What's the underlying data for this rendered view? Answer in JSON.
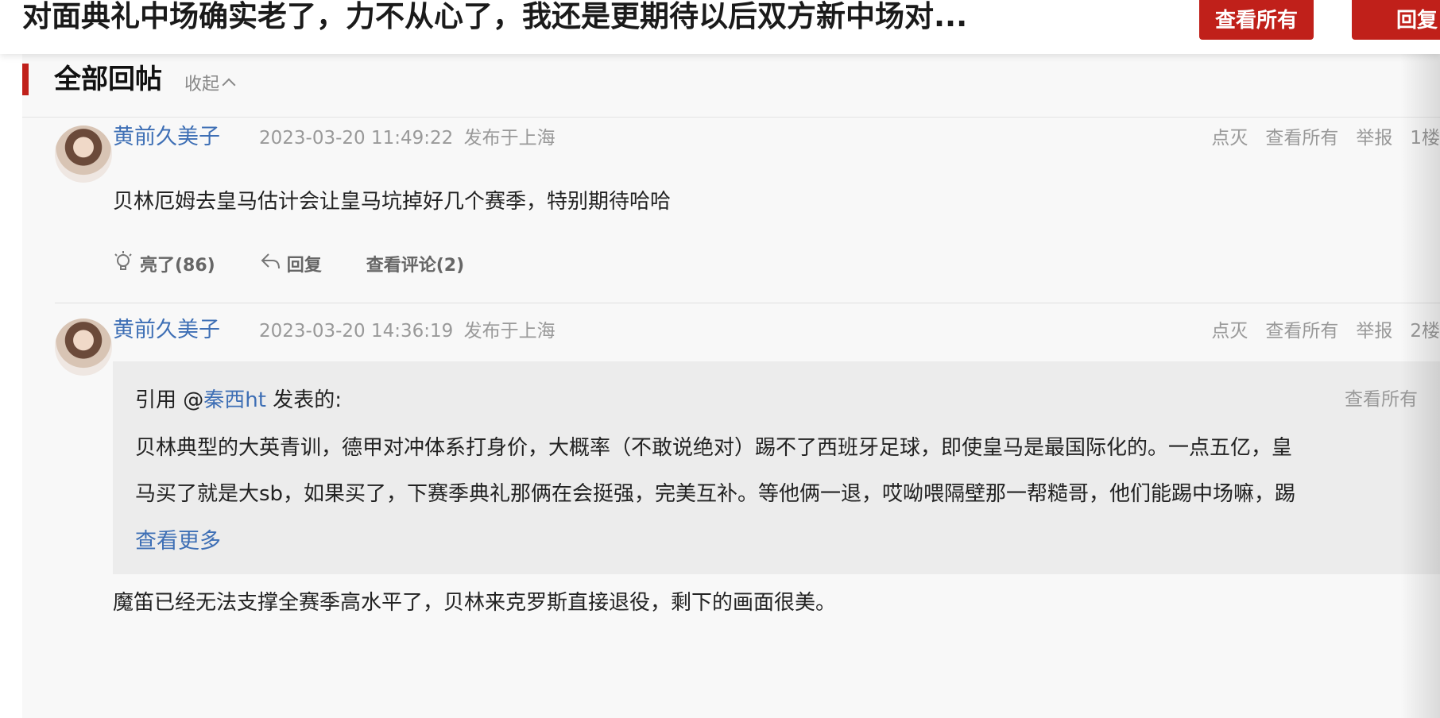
{
  "header": {
    "title": "对面典礼中场确实老了，力不从心了，我还是更期待以后双方新中场对...",
    "view_all_label": "查看所有",
    "reply_label": "回复"
  },
  "section": {
    "title": "全部回帖",
    "collapse_label": "收起"
  },
  "posts": [
    {
      "user": "黄前久美子",
      "time": "2023-03-20 11:49:22",
      "location": "发布于上海",
      "links": [
        "点灭",
        "查看所有",
        "举报",
        "1楼"
      ],
      "text": "贝林厄姆去皇马估计会让皇马坑掉好几个赛季，特别期待哈哈",
      "like_label": "亮了(86)",
      "reply_label": "回复",
      "comments_label": "查看评论(2)"
    },
    {
      "user": "黄前久美子",
      "time": "2023-03-20 14:36:19",
      "location": "发布于上海",
      "links": [
        "点灭",
        "查看所有",
        "举报",
        "2楼"
      ],
      "quote": {
        "prefix": "引用 @",
        "mention": "秦西ht",
        "suffix": " 发表的:",
        "view_all": "查看所有",
        "line1": "贝林典型的大英青训，德甲对冲体系打身价，大概率（不敢说绝对）踢不了西班牙足球，即使皇马是最国际化的。一点五亿，皇",
        "line2": "马买了就是大sb，如果买了，下赛季典礼那俩在会挺强，完美互补。等他俩一退，哎呦喂隔壁那一帮糙哥，他们能踢中场嘛，踢",
        "more": "查看更多"
      },
      "text": "魔笛已经无法支撑全赛季高水平了，贝林来克罗斯直接退役，剩下的画面很美。"
    }
  ],
  "colors": {
    "accent": "#c0201a",
    "link": "#3e6fb5"
  }
}
